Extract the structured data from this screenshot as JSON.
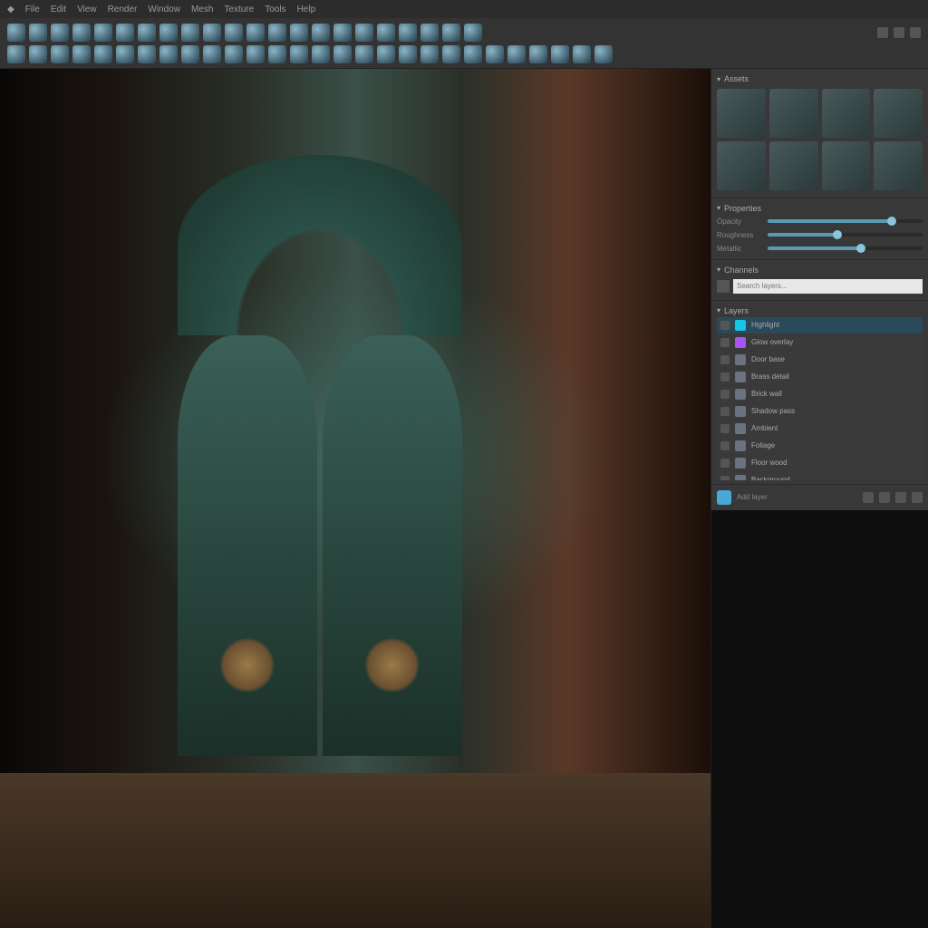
{
  "menubar": {
    "items": [
      "File",
      "Edit",
      "View",
      "Render",
      "Window",
      "Mesh",
      "Texture",
      "Tools",
      "Help"
    ]
  },
  "toolbar": {
    "rows": [
      {
        "count": 22
      },
      {
        "count": 28
      }
    ]
  },
  "right_panel": {
    "assets": {
      "header": "Assets",
      "thumb_count": 8
    },
    "properties": {
      "header": "Properties",
      "sliders": [
        {
          "label": "Opacity",
          "value": 80
        },
        {
          "label": "Roughness",
          "value": 45
        },
        {
          "label": "Metallic",
          "value": 60
        }
      ]
    },
    "channels": {
      "header": "Channels"
    },
    "search": {
      "placeholder": "Search layers..."
    },
    "layers": {
      "header": "Layers",
      "items": [
        {
          "name": "Highlight",
          "color": "#16c5e8",
          "active": true
        },
        {
          "name": "Glow overlay",
          "color": "#a855f7",
          "active": false
        },
        {
          "name": "Door base",
          "color": "#6b7280",
          "active": false
        },
        {
          "name": "Brass detail",
          "color": "#6b7280",
          "active": false
        },
        {
          "name": "Brick wall",
          "color": "#6b7280",
          "active": false
        },
        {
          "name": "Shadow pass",
          "color": "#6b7280",
          "active": false
        },
        {
          "name": "Ambient",
          "color": "#6b7280",
          "active": false
        },
        {
          "name": "Foliage",
          "color": "#6b7280",
          "active": false
        },
        {
          "name": "Floor wood",
          "color": "#6b7280",
          "active": false
        },
        {
          "name": "Background",
          "color": "#6b7280",
          "active": false
        }
      ]
    },
    "footer": {
      "label": "Add layer"
    }
  },
  "colors": {
    "accent": "#4aa8d8",
    "bg_dark": "#1a1a1a",
    "panel": "#383838"
  }
}
